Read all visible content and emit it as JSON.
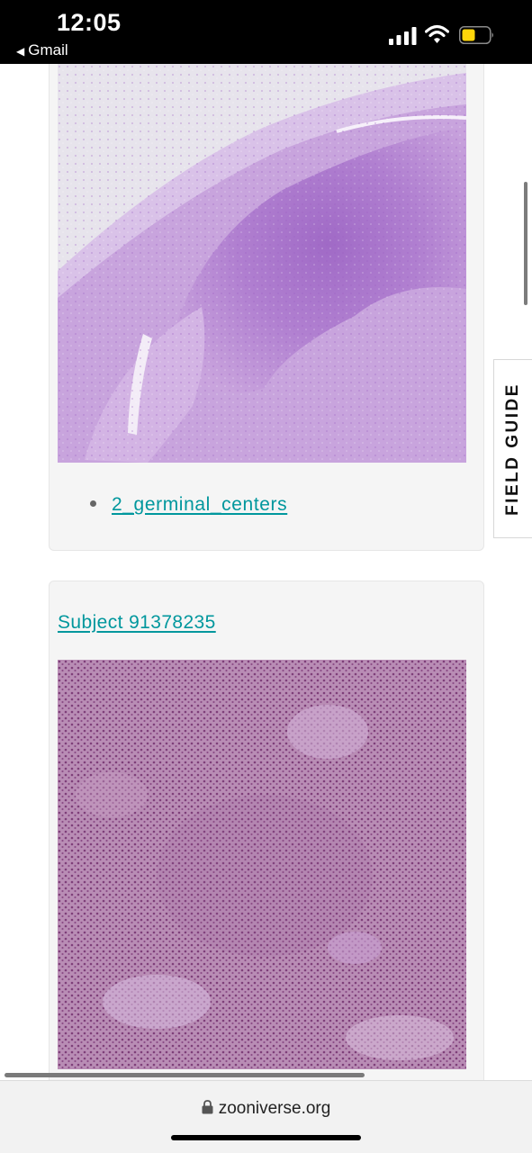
{
  "status_bar": {
    "time": "12:05",
    "back_app": "Gmail",
    "back_icon": "back-triangle-icon",
    "icons": [
      "signal-icon",
      "wifi-icon",
      "battery-icon"
    ],
    "battery_color": "#ffd60a"
  },
  "card_1": {
    "image_alt": "histology-slide-lymph-node-pale-purple",
    "tag": "2_germinal_centers"
  },
  "card_2": {
    "subject_link": "Subject 91378235",
    "image_alt": "histology-slide-lymphocytes-dense-pink"
  },
  "field_guide": {
    "label": "FIELD GUIDE"
  },
  "browser": {
    "url": "zooniverse.org",
    "lock_icon": "lock-icon"
  },
  "colors": {
    "link": "#00979d",
    "card_bg": "#f5f5f5",
    "status_bg": "#000000"
  }
}
